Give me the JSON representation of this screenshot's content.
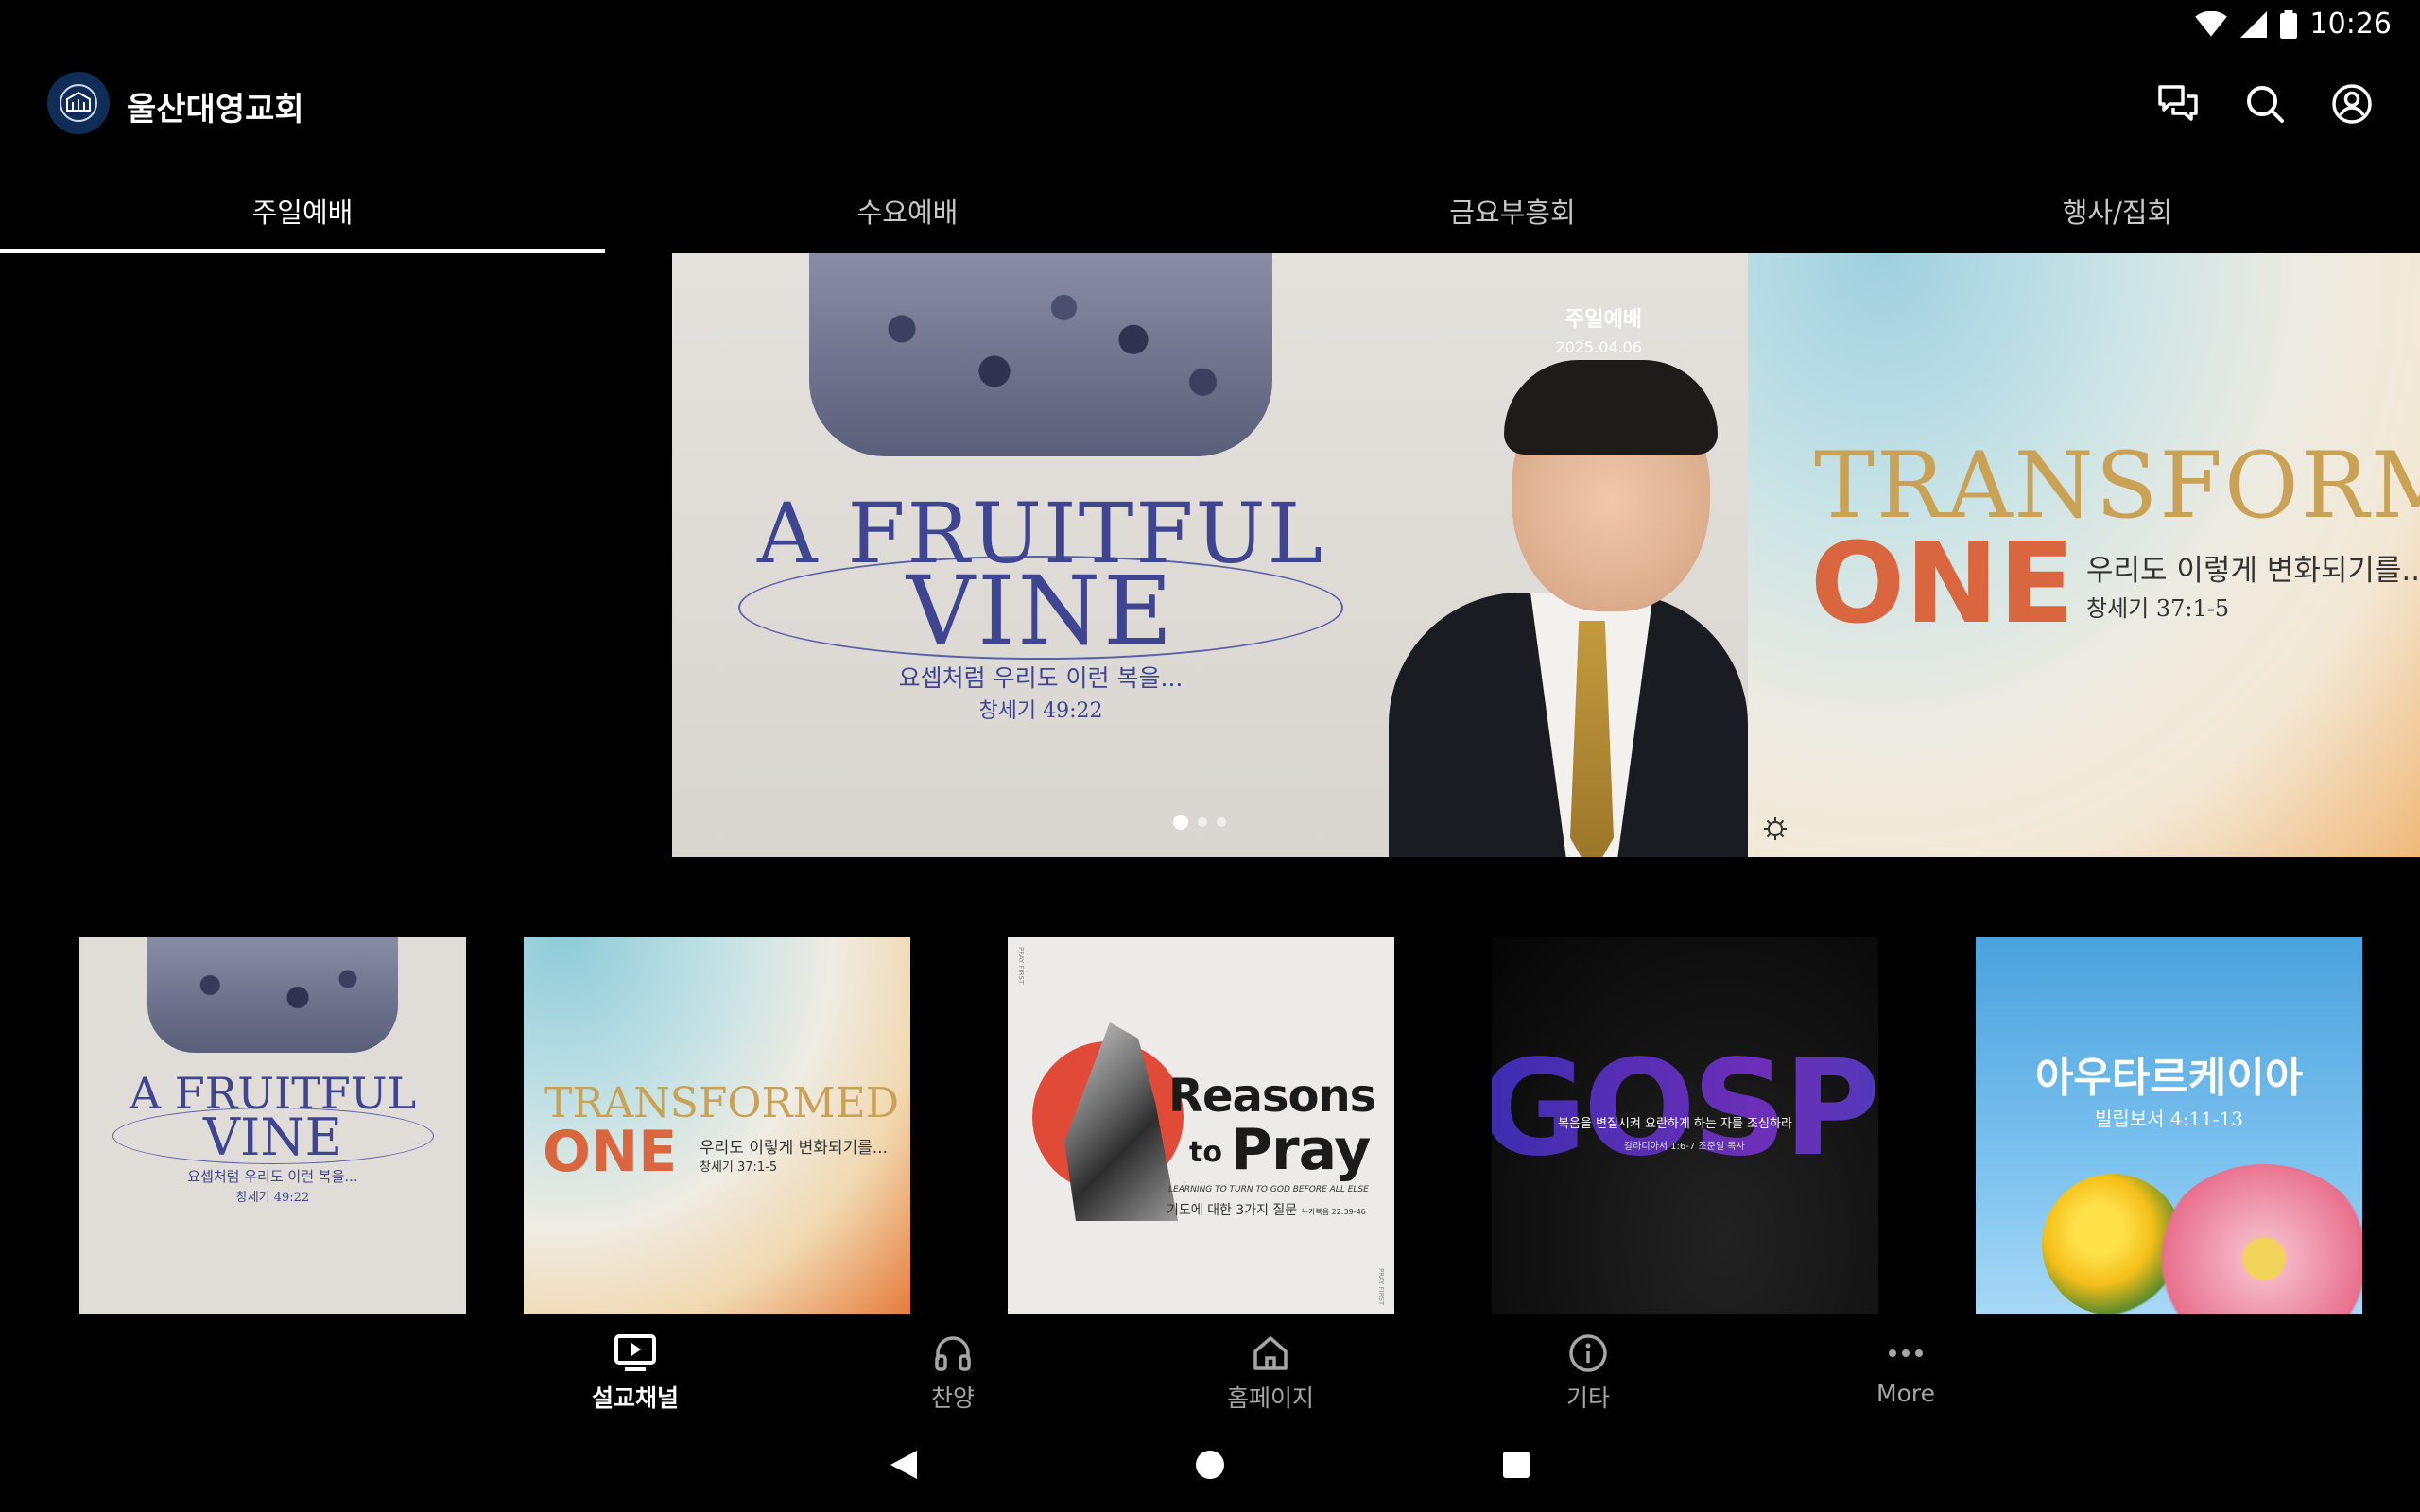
{
  "status_bar": {
    "time": "10:26",
    "icons": [
      "wifi-icon",
      "signal-icon",
      "battery-icon"
    ]
  },
  "app": {
    "title": "울산대영교회",
    "logo": "church-logo-icon"
  },
  "header_actions": [
    {
      "name": "chat-icon"
    },
    {
      "name": "search-icon"
    },
    {
      "name": "account-icon"
    }
  ],
  "tabs": [
    {
      "label": "주일예배",
      "active": true
    },
    {
      "label": "수요예배",
      "active": false
    },
    {
      "label": "금요부흥회",
      "active": false
    },
    {
      "label": "행사/집회",
      "active": false
    }
  ],
  "carousel": {
    "slides": [
      {
        "title_line1": "A FRUITFUL",
        "title_line2": "VINE",
        "subtitle": "요셉처럼 우리도 이런 복을...",
        "scripture": "창세기 49:22",
        "tag": "주일예배",
        "date": "2025.04.06"
      },
      {
        "title_line1": "TRANSFORMED",
        "title_line2": "ONE",
        "subtitle": "우리도 이렇게 변화되기를...",
        "scripture": "창세기 37:1-5"
      }
    ],
    "dot_count": 3,
    "active_dot": 0
  },
  "thumbnails": [
    {
      "title_line1": "A FRUITFUL",
      "title_line2": "VINE",
      "subtitle": "요셉처럼 우리도 이런 복을...",
      "scripture": "창세기 49:22"
    },
    {
      "title_line1": "TRANSFORMED",
      "title_line2": "ONE",
      "subtitle": "우리도 이렇게 변화되기를...",
      "scripture": "창세기 37:1-5"
    },
    {
      "title_line1": "Reasons",
      "title_to": "to",
      "title_line2": "Pray",
      "tagline": "LEARNING TO TURN TO GOD BEFORE ALL ELSE",
      "subtitle": "기도에 대한 3가지 질문",
      "scripture": "누가복음 22:39-46",
      "side_text": "PRAY FIRST"
    },
    {
      "title": "GOSPEL",
      "subtitle": "복음을 변질시켜 요란하게 하는 자를 조심하라",
      "scripture": "갈라디아서 1:6-7  조준일 목사"
    },
    {
      "title": "아우타르케이아",
      "scripture": "빌립보서 4:11-13"
    }
  ],
  "bottom_nav": [
    {
      "label": "설교채널",
      "icon": "tv-play-icon",
      "active": true
    },
    {
      "label": "찬양",
      "icon": "headphones-icon",
      "active": false
    },
    {
      "label": "홈페이지",
      "icon": "home-icon",
      "active": false
    },
    {
      "label": "기타",
      "icon": "info-icon",
      "active": false
    },
    {
      "label": "More",
      "icon": "more-icon",
      "active": false
    }
  ],
  "system_nav": [
    "back-icon",
    "home-circle-icon",
    "recents-icon"
  ],
  "colors": {
    "background": "#000000",
    "accent": "#ffffff",
    "inactive": "#a6a6a6",
    "fruitful_blue": "#3f4591",
    "transformed_gold": "#c9a256",
    "transformed_orange": "#d9663e"
  }
}
